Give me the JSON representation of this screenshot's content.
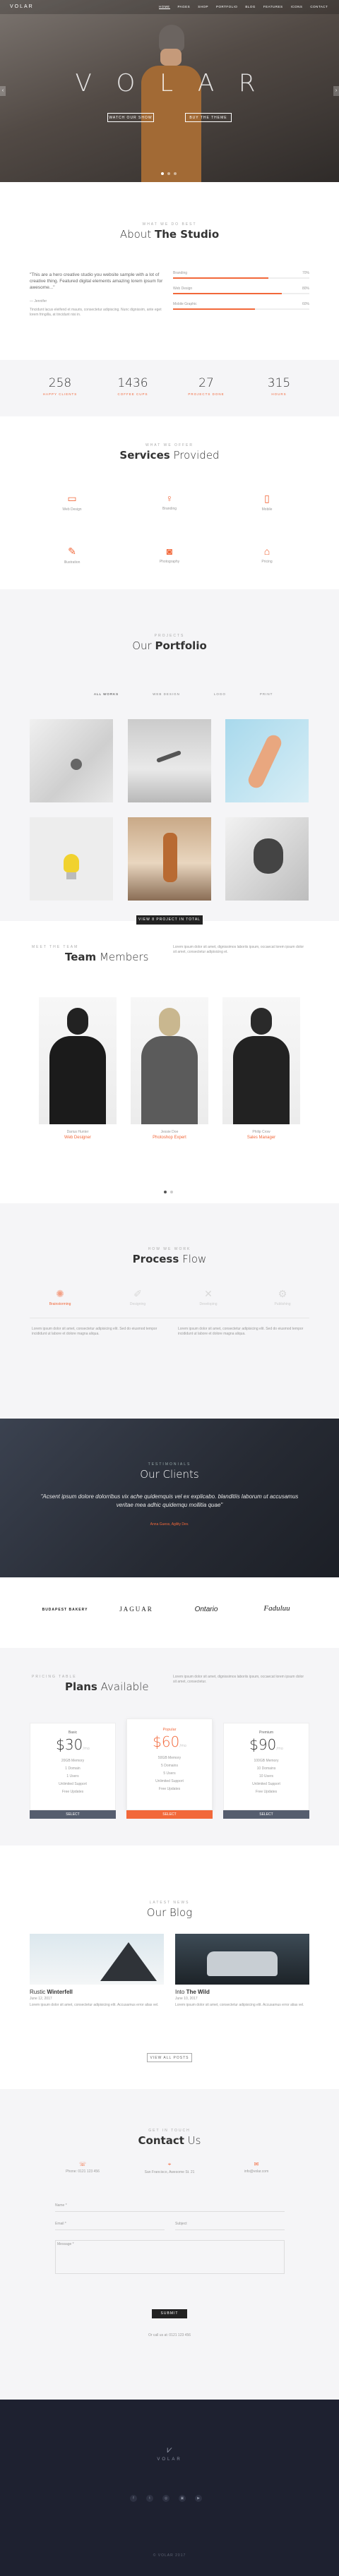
{
  "colors": {
    "accent": "#f2683a",
    "dark": "#1e2130"
  },
  "nav": {
    "logo": "VOLAR",
    "items": [
      "HOME",
      "PAGES",
      "SHOP",
      "PORTFOLIO",
      "BLOG",
      "FEATURES",
      "ICONS",
      "CONTACT"
    ]
  },
  "hero": {
    "title": "V O L A R",
    "btn1": "WATCH OUR SHOW",
    "btn2": "BUY THE THEME"
  },
  "about": {
    "pre": "WHAT WE DO BEST",
    "title_a": "About",
    "title_b": "The Studio",
    "quote": "\"This are a hero creative studio you website sample with a lot of creative thing. Featured digital elements amazing lorem ipsum for awesome...\"",
    "author": "— Jennifer",
    "text": "Tincidunt lacus eleifend et mauris, consectetur adipiscing. Nunc dignissim, ante eget lorem fringilla, at tincidunt nisi in.",
    "skills": [
      {
        "name": "Branding",
        "val": "70%",
        "pct": 0.7
      },
      {
        "name": "Web Design",
        "val": "80%",
        "pct": 0.8
      },
      {
        "name": "Mobile Graphic",
        "val": "60%",
        "pct": 0.6
      }
    ]
  },
  "stats": [
    {
      "num": "258",
      "label": "HAPPY CLIENTS"
    },
    {
      "num": "1436",
      "label": "COFFEE CUPS"
    },
    {
      "num": "27",
      "label": "PROJECTS DONE"
    },
    {
      "num": "315",
      "label": "HOURS"
    }
  ],
  "services": {
    "pre": "WHAT WE OFFER",
    "title_a": "Services",
    "title_b": "Provided",
    "items": [
      "Web Design",
      "Branding",
      "Mobile",
      "Illustration",
      "Photography",
      "Pricing"
    ]
  },
  "portfolio": {
    "pre": "PROJECTS",
    "title_a": "Our",
    "title_b": "Portfolio",
    "filters": [
      "ALL WORKS",
      "WEB DESIGN",
      "LOGO",
      "PRINT"
    ],
    "btn": "VIEW 8 PROJECT IN TOTAL"
  },
  "team": {
    "pre": "MEET THE TEAM",
    "title_a": "Team",
    "title_b": "Members",
    "desc": "Lorem ipsum dolor sit amet, dignissimos laboriis ipsum, occaecat lorem ipsum dolor sit amet, consectetur adipisicing et.",
    "members": [
      {
        "name": "Darius Hunter",
        "role": "Web Designer"
      },
      {
        "name": "Jessie Doe",
        "role": "Photoshop Expert"
      },
      {
        "name": "Philip Crow",
        "role": "Sales Manager"
      }
    ]
  },
  "process": {
    "pre": "HOW WE WORK",
    "title_a": "Process",
    "title_b": "Flow",
    "steps": [
      "Brainstorming",
      "Designing",
      "Developing",
      "Publishing"
    ],
    "text1": "Lorem ipsum dolor sit amet, consectetur adipisicing elit. Sed do eiusmod tempor incididunt ut labore et dolore magna aliqua.",
    "text2": "Lorem ipsum dolor sit amet, consectetur adipisicing elit. Sed do eiusmod tempor incididunt ut labore et dolore magna aliqua."
  },
  "clients": {
    "pre": "TESTIMONIALS",
    "title": "Our Clients",
    "quote": "\"Acsent ipsum dolore dolorribus vix ache quidemquis vel ex explicabo. blanditiis laborum ut accusamus veritae mea adhic quidemqu mollitia quae\"",
    "author": "Anna Guess, Agility Dev.",
    "logos": [
      "BUDAPEST BAKERY",
      "JAGUAR",
      "Ontario",
      "Faduluu"
    ]
  },
  "plans": {
    "pre": "PRICING TABLE",
    "title_a": "Plans",
    "title_b": "Available",
    "desc": "Lorem ipsum dolor sit amet, dignissimos laboriis ipsum, occaecat lorem ipsum dolor sit amet, consectetur.",
    "items": [
      {
        "name": "Basic",
        "price": "30",
        "per": "/mo",
        "f": [
          "20GB Memory",
          "1 Domain",
          "1 Users",
          "Unlimited Support",
          "Free Updates"
        ],
        "btn": "SELECT"
      },
      {
        "name": "Popular",
        "price": "60",
        "per": "/mo",
        "f": [
          "50GB Memory",
          "5 Domains",
          "5 Users",
          "Unlimited Support",
          "Free Updates"
        ],
        "btn": "SELECT"
      },
      {
        "name": "Premium",
        "price": "90",
        "per": "/mo",
        "f": [
          "100GB Memory",
          "10 Domains",
          "10 Users",
          "Unlimited Support",
          "Free Updates"
        ],
        "btn": "SELECT"
      }
    ]
  },
  "blog": {
    "pre": "LATEST NEWS",
    "title": "Our Blog",
    "posts": [
      {
        "title_a": "Rustic",
        "title_b": "Winterfell",
        "text": "Lorem ipsum dolor sit amet, consectetur adipisicing elit. Accusamus error alias vel.",
        "meta": "June 12, 2017"
      },
      {
        "title_a": "Into",
        "title_b": "The Wild",
        "text": "Lorem ipsum dolor sit amet, consectetur adipisicing elit. Accusamus error alias vel.",
        "meta": "June 10, 2017"
      }
    ],
    "btn": "VIEW ALL POSTS"
  },
  "contact": {
    "pre": "GET IN TOUCH",
    "title_a": "Contact",
    "title_b": "Us",
    "info": [
      "Phone: 0121 123 456",
      "San Francisco, Awesome St. 21",
      "info@volar.com"
    ],
    "name_ph": "Name *",
    "email_ph": "Email *",
    "subject_ph": "Subject",
    "msg_ph": "Message *",
    "btn": "SUBMIT",
    "note": "Or call us at: 0121 123 456"
  },
  "footer": {
    "logo": "VOLAR",
    "copy": "© VOLAR 2017"
  }
}
